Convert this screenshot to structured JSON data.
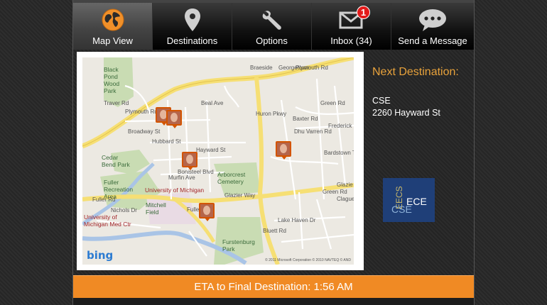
{
  "nav": {
    "tabs": [
      {
        "label": "Map View",
        "icon": "globe-icon",
        "active": true
      },
      {
        "label": "Destinations",
        "icon": "location-pin-icon",
        "active": false
      },
      {
        "label": "Options",
        "icon": "wrench-icon",
        "active": false
      },
      {
        "label": "Inbox (34)",
        "icon": "envelope-icon",
        "active": false,
        "badge": "1"
      },
      {
        "label": "Send a Message",
        "icon": "speech-bubble-icon",
        "active": false
      }
    ]
  },
  "map": {
    "areas": [
      "Black Pond Wood Park",
      "Cedar Bend Park",
      "Fuller Recreation Area",
      "Arborcrest Cemetery",
      "Furstenburg Park"
    ],
    "institutions": [
      "University of Michigan",
      "University of Michigan Med Ctr"
    ],
    "places": [
      "Mitchell Field"
    ],
    "streets": [
      "Plymouth Rd",
      "Plymouth Rd",
      "Broadway St",
      "Traver Rd",
      "Hubbard St",
      "Hayward St",
      "Bonisteel Blvd",
      "Glazier Way",
      "Fuller Rd",
      "Fuller Rd",
      "Nichols Dr",
      "Huron Pkwy",
      "Baxter Rd",
      "Green Rd",
      "Green Rd",
      "Frederick Dr",
      "Dhu Varren Rd",
      "Beal Ave",
      "Murfin Ave",
      "Lake Haven Dr",
      "Bluett Rd",
      "Clague",
      "Glazie",
      "Bardstown Trl",
      "Georgetown",
      "Braeside"
    ],
    "provider": "bing",
    "copyright": "© 2011 Microsoft Corporation  © 2010 NAVTEQ  © AND"
  },
  "sidebar": {
    "heading": "Next Destination:",
    "destination_name": "CSE",
    "destination_address": "2260 Hayward St",
    "logo": {
      "eecs": "EECS",
      "ece": "ECE",
      "cse": "CSE"
    }
  },
  "footer": {
    "eta": "ETA to Final Destination: 1:56 AM"
  },
  "colors": {
    "accent": "#f08a24",
    "heading": "#e8a23b",
    "badge": "#e31b1b",
    "logo_bg": "#1f3f78"
  }
}
